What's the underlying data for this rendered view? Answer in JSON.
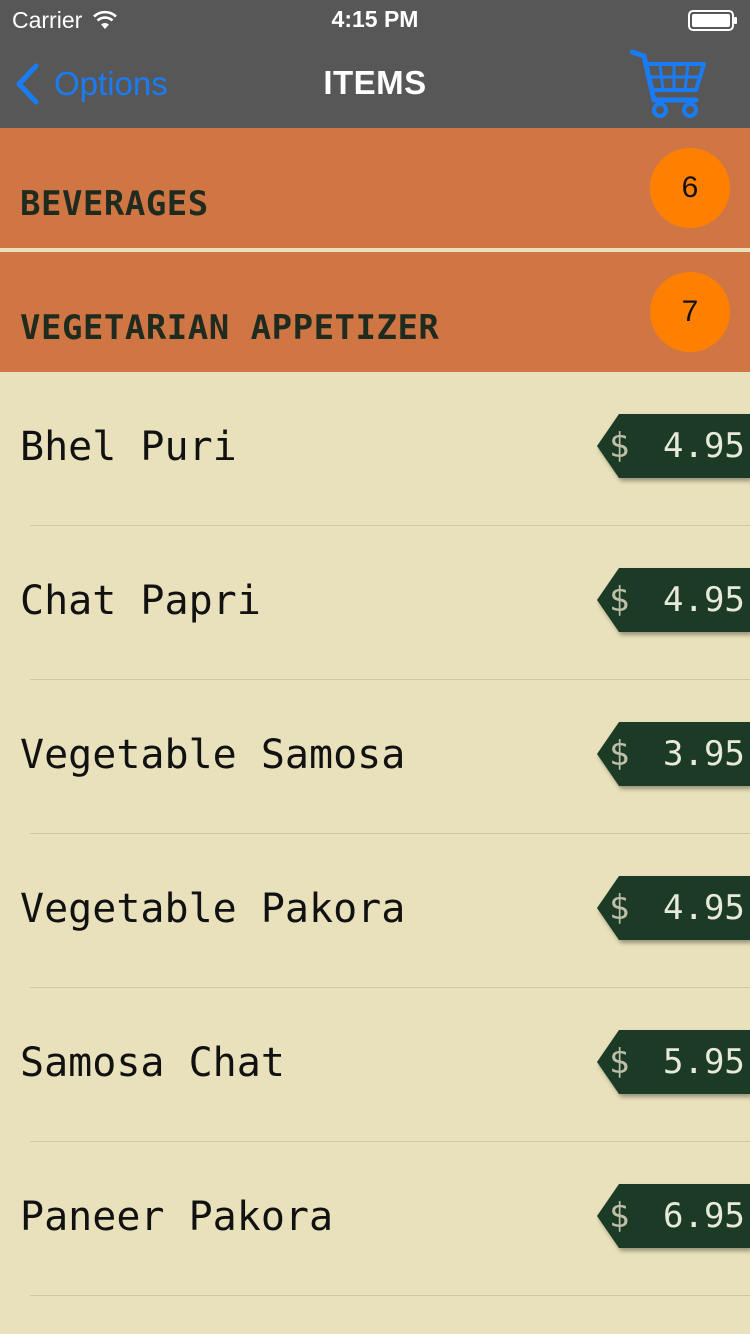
{
  "status_bar": {
    "carrier": "Carrier",
    "time": "4:15 PM"
  },
  "nav": {
    "back_label": "Options",
    "title": "ITEMS",
    "cart_icon": "shopping-cart-icon",
    "accent_color": "#1a7cf5"
  },
  "categories": [
    {
      "title": "BEVERAGES",
      "count": "6"
    },
    {
      "title": "VEGETARIAN APPETIZER",
      "count": "7"
    }
  ],
  "items": [
    {
      "name": "Bhel Puri",
      "currency": "$",
      "price": "4.95"
    },
    {
      "name": "Chat Papri",
      "currency": "$",
      "price": "4.95"
    },
    {
      "name": "Vegetable Samosa",
      "currency": "$",
      "price": "3.95"
    },
    {
      "name": "Vegetable Pakora",
      "currency": "$",
      "price": "4.95"
    },
    {
      "name": "Samosa Chat",
      "currency": "$",
      "price": "5.95"
    },
    {
      "name": "Paneer Pakora",
      "currency": "$",
      "price": "6.95"
    }
  ],
  "colors": {
    "bar": "#575757",
    "category": "#d07645",
    "badge": "#ff8000",
    "background": "#e8e1bb",
    "price_tag": "#1c3b26"
  }
}
